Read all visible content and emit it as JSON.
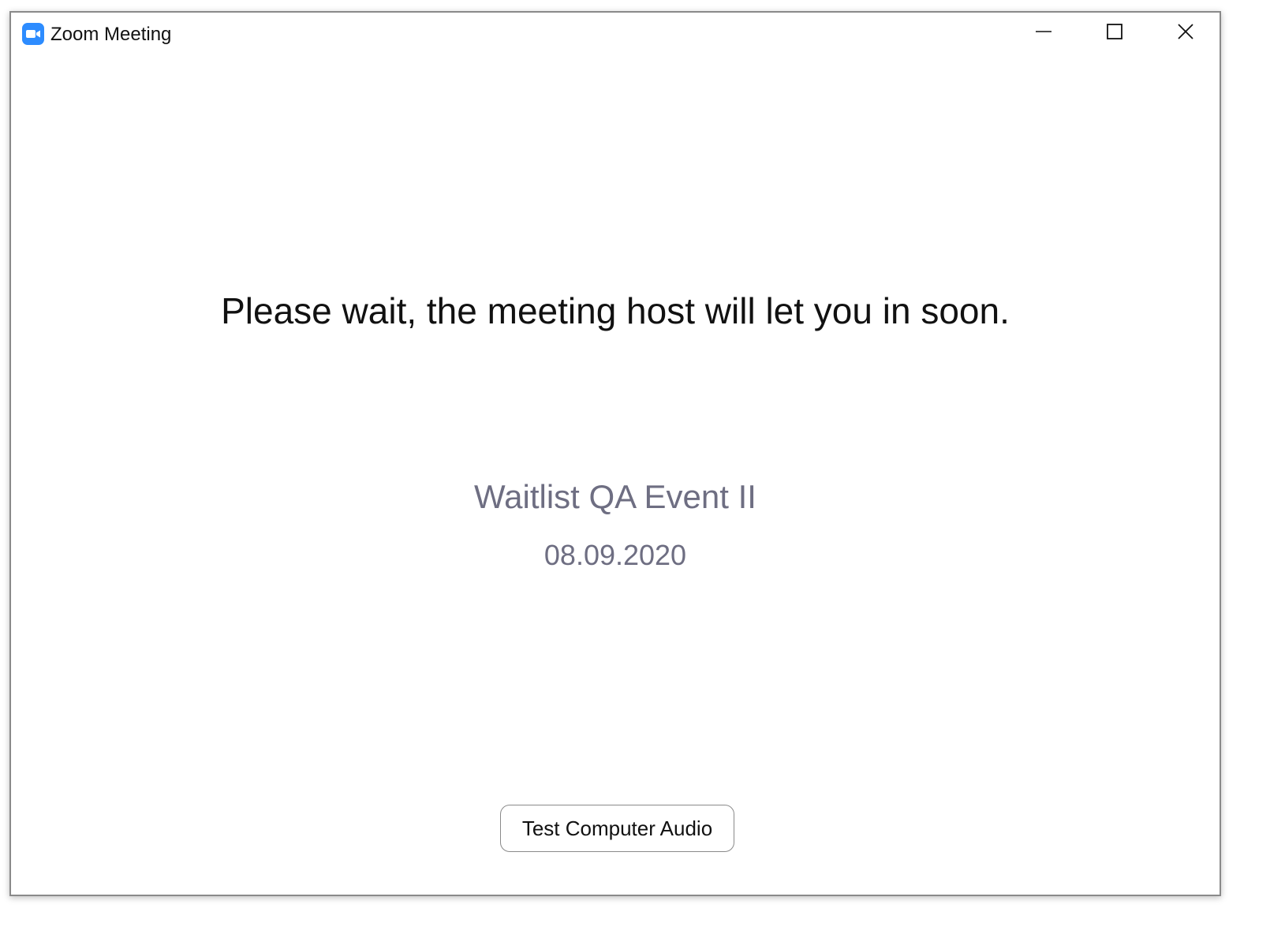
{
  "window": {
    "title": "Zoom Meeting",
    "app_icon": "zoom-camera-icon",
    "controls": {
      "minimize_icon": "minimize-icon",
      "maximize_icon": "maximize-icon",
      "close_icon": "close-icon"
    }
  },
  "main": {
    "wait_message": "Please wait, the meeting host will let you in soon.",
    "event_name": "Waitlist QA Event II",
    "event_date": "08.09.2020",
    "test_audio_label": "Test Computer Audio"
  },
  "colors": {
    "brand": "#2d8cff",
    "secondary_text": "#6e6e82"
  }
}
